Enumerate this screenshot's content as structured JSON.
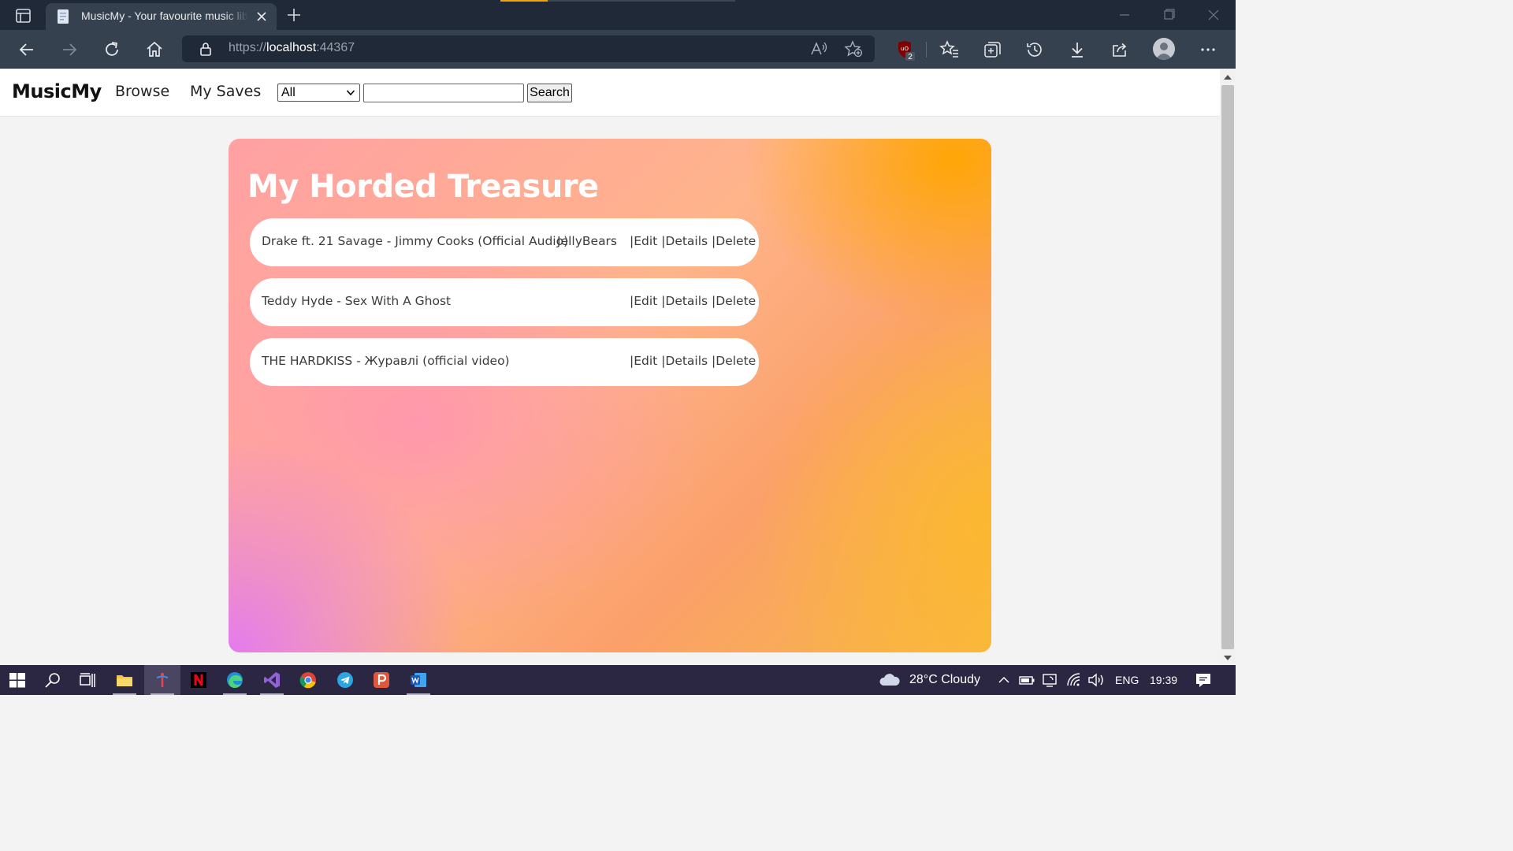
{
  "browser": {
    "tab_title": "MusicMy - Your favourite music library",
    "url_scheme": "https://",
    "url_host": "localhost",
    "url_port": ":44367",
    "extension_badge": "2"
  },
  "site": {
    "brand": "MusicMy",
    "nav": [
      {
        "label": "Browse"
      },
      {
        "label": "My Saves"
      }
    ],
    "filter_selected": "All",
    "search_value": "",
    "search_button": "Search"
  },
  "panel": {
    "title": "My Horded Treasure",
    "rows": [
      {
        "song": "Drake ft. 21 Savage - Jimmy Cooks (Official Audio)",
        "user": "JellyBears",
        "actions": "|Edit |Details |Delete"
      },
      {
        "song": "Teddy Hyde - Sex With A Ghost",
        "user": "",
        "actions": "|Edit |Details |Delete"
      },
      {
        "song": "THE HARDKISS - Журавлі (official video)",
        "user": "",
        "actions": "|Edit |Details |Delete"
      }
    ]
  },
  "taskbar": {
    "weather": "28°C  Cloudy",
    "language": "ENG",
    "time": "19:39"
  },
  "colors": {
    "browser_frame": "#1f2937",
    "browser_toolbar": "#35414f",
    "taskbar": "#2b2641",
    "panel_orange": "#ffa600",
    "panel_pink": "#ff92b4",
    "panel_violet": "#e278f2"
  }
}
